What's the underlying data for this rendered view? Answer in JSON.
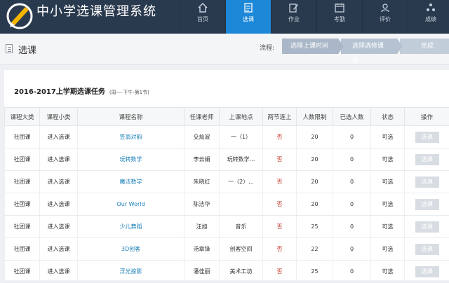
{
  "app": {
    "title": "中小学选课管理系统"
  },
  "nav": [
    {
      "label": "首页",
      "icon": "home-icon",
      "active": false
    },
    {
      "label": "选课",
      "icon": "document-icon",
      "active": true
    },
    {
      "label": "作业",
      "icon": "edit-icon",
      "active": false
    },
    {
      "label": "考勤",
      "icon": "attendance-icon",
      "active": false
    },
    {
      "label": "评价",
      "icon": "evaluation-icon",
      "active": false
    },
    {
      "label": "成绩",
      "icon": "grades-icon",
      "active": false
    }
  ],
  "page": {
    "title": "选课"
  },
  "flow": {
    "label": "流程:",
    "steps": [
      "选择上课时间",
      "选择选修课程",
      "完成"
    ]
  },
  "task": {
    "title": "2016-2017上学期选课任务",
    "subtitle": "(周一-下午-第1节)"
  },
  "table": {
    "headers": [
      "课程大类",
      "课程小类",
      "课程名称",
      "任课老师",
      "上课地点",
      "两节连上",
      "人数限制",
      "已选人数",
      "状态",
      "操作"
    ],
    "rows": [
      [
        "社团课",
        "进入选课",
        "笠翁对韵",
        "殳灿波",
        "一（1）",
        "否",
        "20",
        "0",
        "可选",
        "选课"
      ],
      [
        "社团课",
        "进入选课",
        "玩转数学",
        "李云娟",
        "玩转数学...",
        "否",
        "20",
        "0",
        "可选",
        "选课"
      ],
      [
        "社团课",
        "进入选课",
        "魔法数学",
        "朱晓红",
        "一（2）...",
        "否",
        "20",
        "0",
        "可选",
        "选课"
      ],
      [
        "社团课",
        "进入选课",
        "Our World",
        "陈洁华",
        "",
        "否",
        "20",
        "0",
        "可选",
        "选课"
      ],
      [
        "社团课",
        "进入选课",
        "少儿舞蹈",
        "汪旭",
        "音乐",
        "否",
        "25",
        "0",
        "可选",
        "选课"
      ],
      [
        "社团课",
        "进入选课",
        "3D创客",
        "汤章锋",
        "创客空间",
        "否",
        "22",
        "0",
        "可选",
        "选课"
      ],
      [
        "社团课",
        "进入选课",
        "浮光掠影",
        "潘佳丽",
        "美术工坊",
        "否",
        "25",
        "0",
        "可选",
        "选课"
      ]
    ]
  },
  "colors": {
    "header": "#2a3a4e",
    "active_nav": "#1e88d8",
    "course_link": "#1a7fb8",
    "no_text": "#c0392b"
  }
}
